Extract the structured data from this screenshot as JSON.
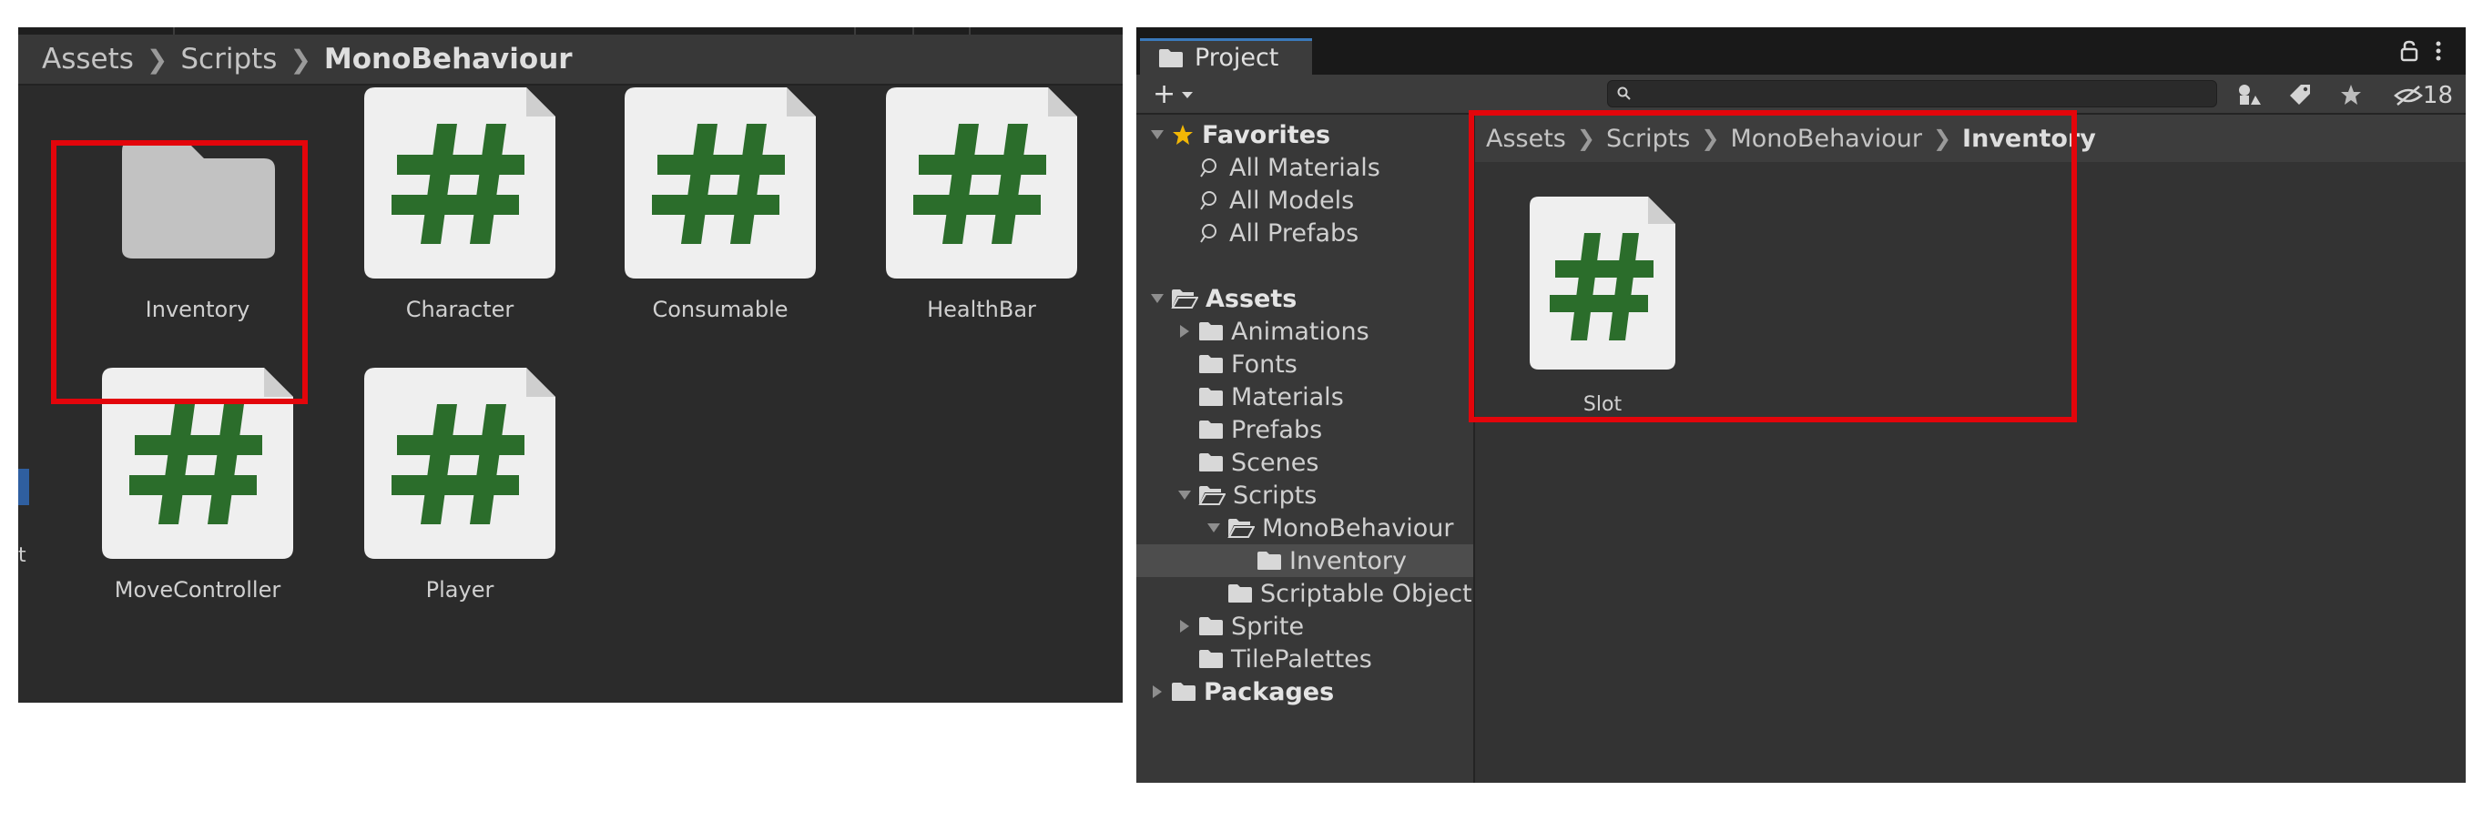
{
  "left": {
    "breadcrumb": [
      "Assets",
      "Scripts",
      "MonoBehaviour"
    ],
    "assets": [
      {
        "name": "Inventory",
        "type": "folder"
      },
      {
        "name": "Character",
        "type": "script"
      },
      {
        "name": "Consumable",
        "type": "script"
      },
      {
        "name": "HealthBar",
        "type": "script"
      },
      {
        "name": "MoveController",
        "type": "script"
      },
      {
        "name": "Player",
        "type": "script"
      }
    ],
    "edge_text": "t"
  },
  "right": {
    "tab_label": "Project",
    "add_label": "+",
    "search": {
      "value": "",
      "placeholder": ""
    },
    "hidden_count": "18",
    "tree": {
      "favorites": "Favorites",
      "all_materials": "All Materials",
      "all_models": "All Models",
      "all_prefabs": "All Prefabs",
      "assets": "Assets",
      "animations": "Animations",
      "fonts": "Fonts",
      "materials": "Materials",
      "prefabs": "Prefabs",
      "scenes": "Scenes",
      "scripts": "Scripts",
      "monobehaviour": "MonoBehaviour",
      "inventory": "Inventory",
      "scriptable_objects": "Scriptable Object",
      "sprite": "Sprite",
      "tilepalettes": "TilePalettes",
      "packages": "Packages"
    },
    "breadcrumb": [
      "Assets",
      "Scripts",
      "MonoBehaviour",
      "Inventory"
    ],
    "assets": [
      {
        "name": "Slot",
        "type": "script"
      }
    ]
  },
  "colors": {
    "highlight": "#e3050b",
    "script_hash": "#2b6d2b",
    "script_page": "#efefef",
    "folder": "#c2c2c2",
    "favorites_star": "#f2b705",
    "tab_accent": "#3a79bb"
  },
  "icons": [
    "folder-icon",
    "script-icon",
    "search-icon",
    "lock-icon",
    "more-icon",
    "star-icon",
    "tag-icon",
    "filter-icon",
    "eye-hidden-icon",
    "chevron-right-icon",
    "triangle-right-icon",
    "triangle-down-icon"
  ]
}
